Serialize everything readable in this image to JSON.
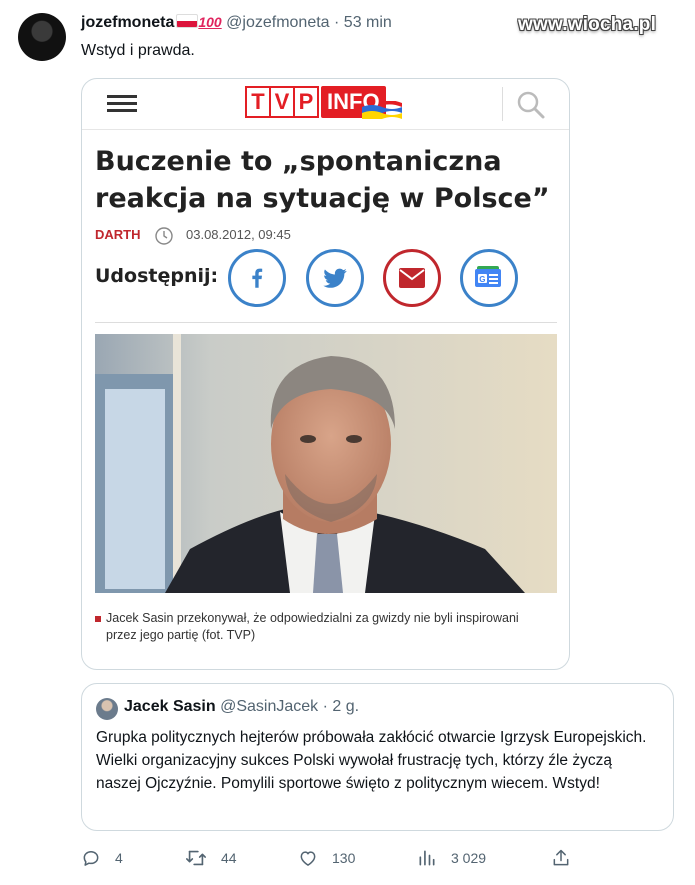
{
  "watermark": "www.wiocha.pl",
  "tweet": {
    "display_name": "jozefmoneta",
    "name_emoji": "💯",
    "handle": "@jozefmoneta",
    "separator": "·",
    "time": "53 min",
    "text": "Wstyd i prawda."
  },
  "article": {
    "logo_tvp": [
      "T",
      "V",
      "P"
    ],
    "logo_info": "INFO",
    "headline": "Buczenie to „spontaniczna reakcja na sytuację w Polsce”",
    "author": "DARTH",
    "date": "03.08.2012, 09:45",
    "share_label": "Udostępnij:",
    "share_icons": [
      "facebook-icon",
      "twitter-icon",
      "mail-icon",
      "google-news-icon"
    ],
    "caption": "Jacek Sasin przekonywał, że odpowiedzialni za gwizdy nie byli inspirowani przez jego partię (fot. TVP)",
    "colors": {
      "tvp_red": "#e31e24",
      "share_blue": "#3b82c9",
      "share_red": "#c0272d"
    }
  },
  "quoted_tweet": {
    "display_name": "Jacek Sasin",
    "handle": "@SasinJacek",
    "separator": "·",
    "time": "2 g.",
    "text": "Grupka politycznych hejterów próbowała zakłócić otwarcie Igrzysk Europejskich. Wielki organizacyjny sukces Polski wywołał frustrację tych, którzy źle życzą naszej Ojczyźnie. Pomylili sportowe święto z politycznym wiecem. Wstyd!"
  },
  "actions": {
    "replies": "4",
    "retweets": "44",
    "likes": "130",
    "views": "3 029"
  }
}
